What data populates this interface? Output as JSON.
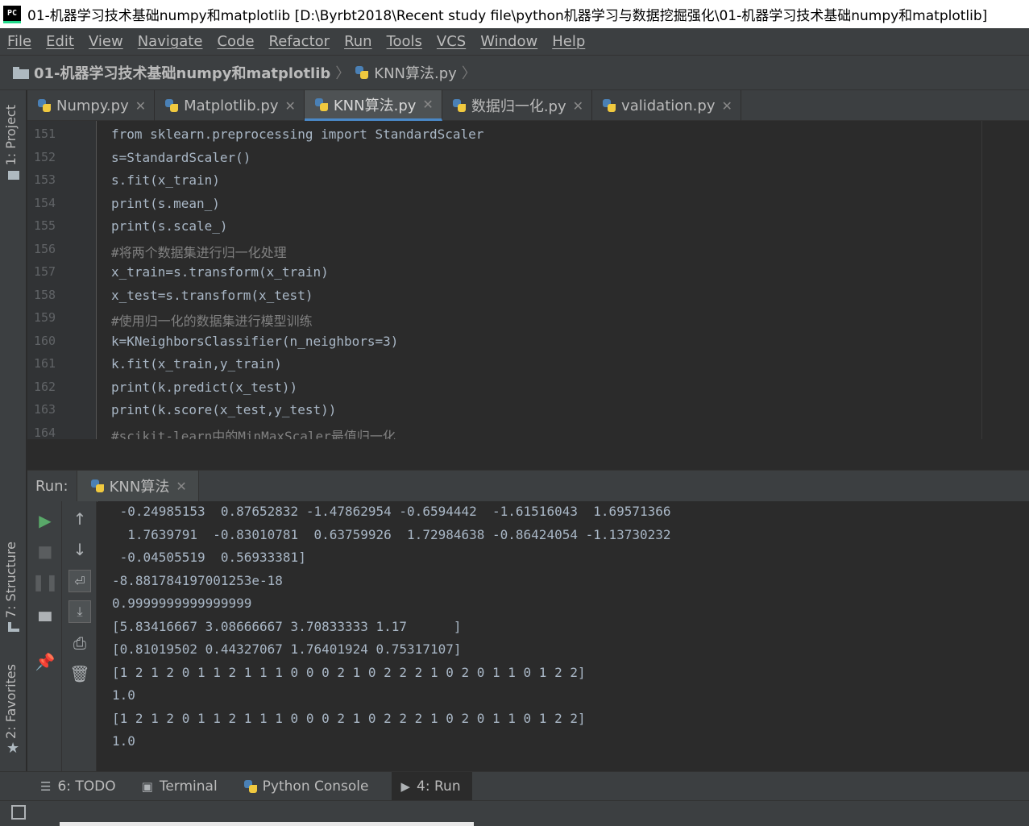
{
  "window": {
    "app_icon": "PC",
    "title": "01-机器学习技术基础numpy和matplotlib [D:\\Byrbt2018\\Recent study file\\python机器学习与数据挖掘强化\\01-机器学习技术基础numpy和matplotlib]"
  },
  "menu": [
    "File",
    "Edit",
    "View",
    "Navigate",
    "Code",
    "Refactor",
    "Run",
    "Tools",
    "VCS",
    "Window",
    "Help"
  ],
  "navbar": {
    "project": "01-机器学习技术基础numpy和matplotlib",
    "file": "KNN算法.py",
    "separator": "〉"
  },
  "left_strip": {
    "project_tab": "1: Project",
    "structure_tab": "7: Structure",
    "favorites_tab": "2: Favorites"
  },
  "editor_tabs": [
    {
      "label": "Numpy.py",
      "active": false
    },
    {
      "label": "Matplotlib.py",
      "active": false
    },
    {
      "label": "KNN算法.py",
      "active": true
    },
    {
      "label": "数据归一化.py",
      "active": false
    },
    {
      "label": "validation.py",
      "active": false
    }
  ],
  "code_lines": [
    {
      "n": "151",
      "text": "from sklearn.preprocessing import StandardScaler"
    },
    {
      "n": "152",
      "text": "s=StandardScaler()"
    },
    {
      "n": "153",
      "text": "s.fit(x_train)"
    },
    {
      "n": "154",
      "text": "print(s.mean_)"
    },
    {
      "n": "155",
      "text": "print(s.scale_)"
    },
    {
      "n": "156",
      "text": "#将两个数据集进行归一化处理"
    },
    {
      "n": "157",
      "text": "x_train=s.transform(x_train)"
    },
    {
      "n": "158",
      "text": "x_test=s.transform(x_test)"
    },
    {
      "n": "159",
      "text": "#使用归一化的数据集进行模型训练"
    },
    {
      "n": "160",
      "text": "k=KNeighborsClassifier(n_neighbors=3)"
    },
    {
      "n": "161",
      "text": "k.fit(x_train,y_train)"
    },
    {
      "n": "162",
      "text": "print(k.predict(x_test))"
    },
    {
      "n": "163",
      "text": "print(k.score(x_test,y_test))"
    },
    {
      "n": "164",
      "text": "#scikit-learn中的MinMaxScaler最值归一化"
    }
  ],
  "run": {
    "label": "Run:",
    "tab": "KNN算法"
  },
  "console_lines": [
    " -0.24985153  0.87652832 -1.47862954 -0.6594442  -1.61516043  1.69571366",
    "  1.7639791  -0.83010781  0.63759926  1.72984638 -0.86424054 -1.13730232",
    " -0.04505519  0.56933381]",
    "-8.881784197001253e-18",
    "0.9999999999999999",
    "[5.83416667 3.08666667 3.70833333 1.17      ]",
    "[0.81019502 0.44327067 1.76401924 0.75317107]",
    "[1 2 1 2 0 1 1 2 1 1 1 0 0 0 2 1 0 2 2 2 1 0 2 0 1 1 0 1 2 2]",
    "1.0",
    "[1 2 1 2 0 1 1 2 1 1 1 0 0 0 2 1 0 2 2 2 1 0 2 0 1 1 0 1 2 2]",
    "1.0"
  ],
  "bottom_tabs": [
    {
      "label": "6: TODO",
      "icon": "list-icon",
      "active": false
    },
    {
      "label": "Terminal",
      "icon": "terminal-icon",
      "active": false
    },
    {
      "label": "Python Console",
      "icon": "python-icon",
      "active": false
    },
    {
      "label": "4: Run",
      "icon": "run-icon",
      "active": true
    }
  ]
}
